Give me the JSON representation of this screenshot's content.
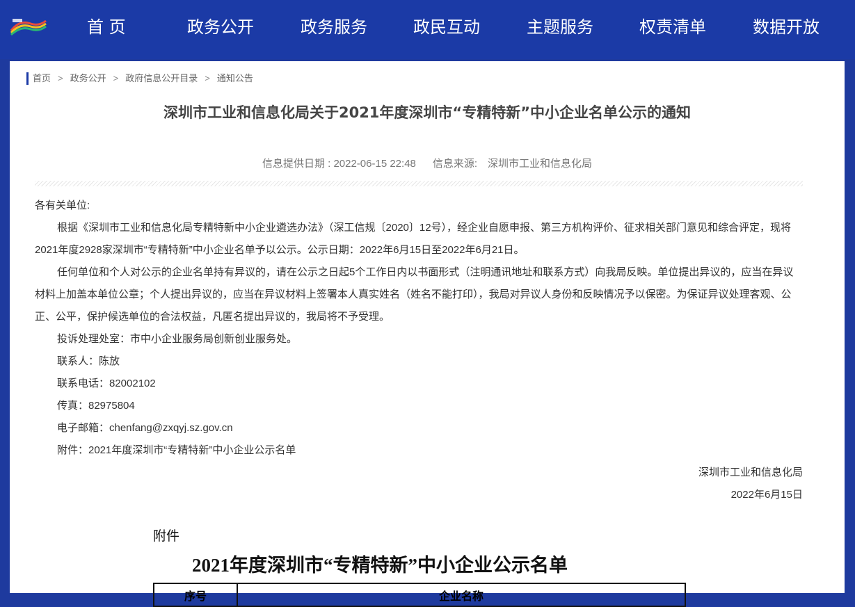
{
  "nav": {
    "logo_icon": "shenzhen-rainbow-logo",
    "items": [
      "首 页",
      "政务公开",
      "政务服务",
      "政民互动",
      "主题服务",
      "权责清单",
      "数据开放"
    ]
  },
  "breadcrumb": [
    "首页",
    "政务公开",
    "政府信息公开目录",
    "通知公告"
  ],
  "article": {
    "title": "深圳市工业和信息化局关于2021年度深圳市“专精特新”中小企业名单公示的通知",
    "date_label": "信息提供日期 : 2022-06-15 22:48",
    "source_label": "信息来源:　深圳市工业和信息化局",
    "salutation": "各有关单位:",
    "para1": "根据《深圳市工业和信息化局专精特新中小企业遴选办法》（深工信规〔2020〕12号），经企业自愿申报、第三方机构评价、征求相关部门意见和综合评定，现将2021年度2928家深圳市“专精特新”中小企业名单予以公示。公示日期：2022年6月15日至2022年6月21日。",
    "para2": "任何单位和个人对公示的企业名单持有异议的，请在公示之日起5个工作日内以书面形式（注明通讯地址和联系方式）向我局反映。单位提出异议的，应当在异议材料上加盖本单位公章；个人提出异议的，应当在异议材料上签署本人真实姓名（姓名不能打印），我局对异议人身份和反映情况予以保密。为保证异议处理客观、公正、公平，保护候选单位的合法权益，凡匿名提出异议的，我局将不予受理。",
    "office": "投诉处理处室：市中小企业服务局创新创业服务处。",
    "contact": "联系人：陈放",
    "phone": "联系电话：82002102",
    "fax": "传真：82975804",
    "email": "电子邮箱：chenfang@zxqyj.sz.gov.cn",
    "attachment_link": "附件：2021年度深圳市“专精特新”中小企业公示名单",
    "signature_org": "深圳市工业和信息化局",
    "signature_date": "2022年6月15日"
  },
  "attachment": {
    "label": "附件",
    "title": "2021年度深圳市“专精特新”中小企业公示名单",
    "columns": [
      "序号",
      "企业名称"
    ]
  }
}
